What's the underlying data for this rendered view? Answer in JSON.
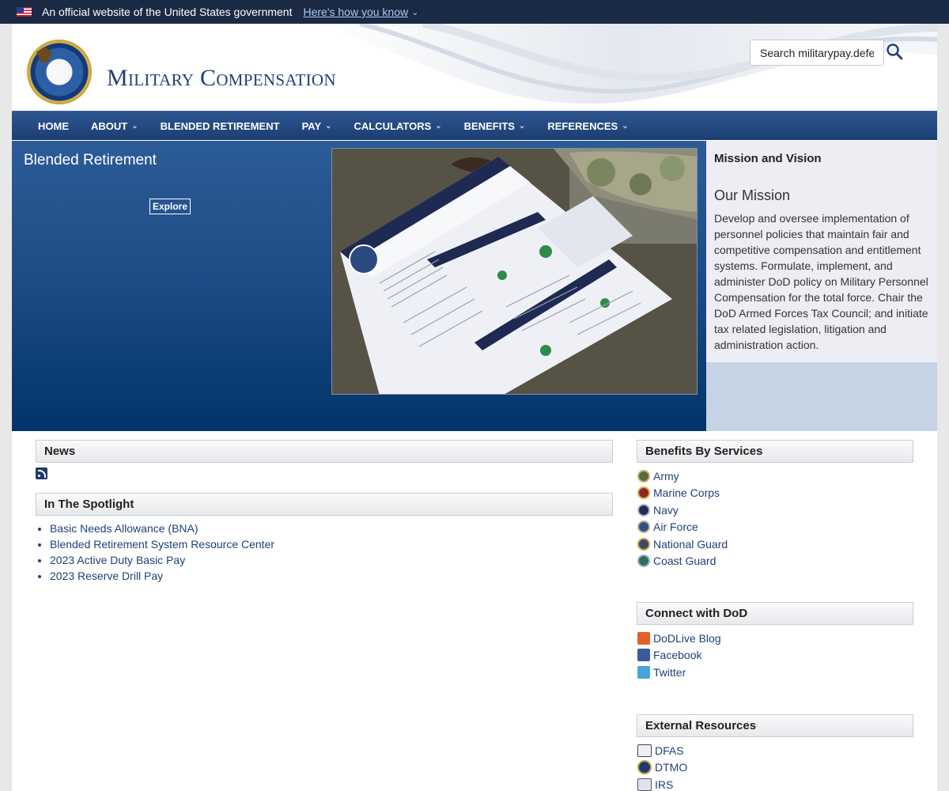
{
  "gov_banner": {
    "official": "An official website of the United States government",
    "howknow": "Here's how you know"
  },
  "header": {
    "title": "Military Compensation",
    "search_placeholder": "Search militarypay.defense.gov"
  },
  "nav": [
    {
      "label": "HOME",
      "dropdown": false
    },
    {
      "label": "ABOUT",
      "dropdown": true
    },
    {
      "label": "BLENDED RETIREMENT",
      "dropdown": false
    },
    {
      "label": "PAY",
      "dropdown": true
    },
    {
      "label": "CALCULATORS",
      "dropdown": true
    },
    {
      "label": "BENEFITS",
      "dropdown": true
    },
    {
      "label": "REFERENCES",
      "dropdown": true
    }
  ],
  "hero": {
    "title": "Blended Retirement",
    "button": "Explore"
  },
  "mission": {
    "heading": "Mission and Vision",
    "title": "Our Mission",
    "text": "Develop and oversee implementation of personnel policies that maintain fair and competitive compensation and entitlement systems. Formulate, implement, and administer DoD policy on Military Personnel Compensation for the total force. Chair the DoD Armed Forces Tax Council; and initiate tax related legislation, litigation and administration action."
  },
  "news": {
    "heading": "News"
  },
  "spotlight": {
    "heading": "In The Spotlight",
    "items": [
      "Basic Needs Allowance (BNA)",
      "Blended Retirement System Resource Center",
      "2023 Active Duty Basic Pay",
      "2023 Reserve Drill Pay"
    ]
  },
  "benefits": {
    "heading": "Benefits By Services",
    "items": [
      {
        "label": "Army",
        "color": "#5a6b3a"
      },
      {
        "label": "Marine Corps",
        "color": "#8b2a22"
      },
      {
        "label": "Navy",
        "color": "#1f2f55"
      },
      {
        "label": "Air Force",
        "color": "#2f4f8f"
      },
      {
        "label": "National Guard",
        "color": "#3b4a6a"
      },
      {
        "label": "Coast Guard",
        "color": "#2d6d5f"
      }
    ]
  },
  "connect": {
    "heading": "Connect with DoD",
    "items": [
      {
        "label": "DoDLive Blog",
        "color": "#e2612a"
      },
      {
        "label": "Facebook",
        "color": "#3b5a9a"
      },
      {
        "label": "Twitter",
        "color": "#49a4dc"
      }
    ]
  },
  "external": {
    "heading": "External Resources",
    "items": [
      {
        "label": "DFAS",
        "color": "#445"
      },
      {
        "label": "DTMO",
        "color": "#1e3a70"
      },
      {
        "label": "IRS",
        "color": "#556"
      }
    ]
  }
}
